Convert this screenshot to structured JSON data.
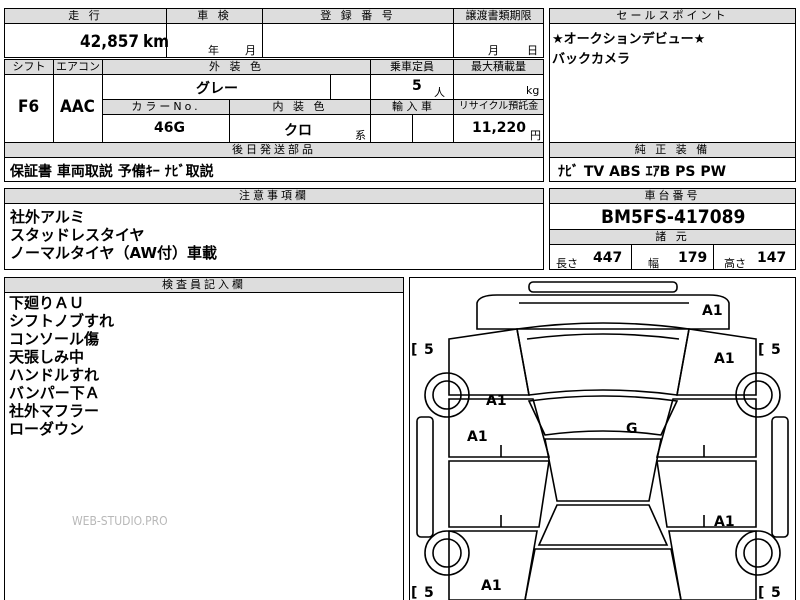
{
  "top": {
    "mileage_label": "走 行",
    "mileage_value": "42,857",
    "mileage_unit": "km",
    "inspection_label": "車 検",
    "inspection_year": "年",
    "inspection_month": "月",
    "registration_label": "登 録 番 号",
    "transfer_label": "譲渡書類期限",
    "transfer_month": "月",
    "transfer_day": "日"
  },
  "sales_point": {
    "label": "セールスポイント",
    "lines": [
      "★オークションデビュー★",
      "バックカメラ"
    ]
  },
  "row2": {
    "shift_label": "シフト",
    "shift_value": "F6",
    "aircon_label": "エアコン",
    "aircon_value": "AAC",
    "exterior_label": "外 装 色",
    "exterior_value": "グレー",
    "capacity_label": "乗車定員",
    "capacity_value": "5",
    "capacity_unit": "人",
    "load_label": "最大積載量",
    "load_unit": "kg",
    "color_no_label": "カラーNo.",
    "color_no_value": "46G",
    "interior_label": "内 装 色",
    "interior_value": "クロ",
    "interior_unit": "系",
    "import_label": "輸 入 車",
    "recycle_label": "リサイクル預託金",
    "recycle_value": "11,220",
    "recycle_unit": "円"
  },
  "later_parts": {
    "label": "後日発送部品",
    "value": "保証書 車両取説 予備ｷｰ ﾅﾋﾞ取説"
  },
  "equipment": {
    "label": "純 正 装 備",
    "value": "ﾅﾋﾞ TV ABS ｴｱB PS PW"
  },
  "notes": {
    "label": "注意事項欄",
    "lines": [
      "社外アルミ",
      "スタッドレスタイヤ",
      "ノーマルタイヤ（AW付）車載"
    ]
  },
  "chassis": {
    "label": "車台番号",
    "value": "BM5FS-417089"
  },
  "specs": {
    "label": "諸 元",
    "length_label": "長さ",
    "length_value": "447",
    "width_label": "幅",
    "width_value": "179",
    "height_label": "高さ",
    "height_value": "147"
  },
  "inspector": {
    "label": "検査員記入欄",
    "lines": [
      "下廻りＡＵ",
      "シフトノブすれ",
      "コンソール傷",
      "天張しみ中",
      "ハンドルすれ",
      "バンパー下Ａ",
      "社外マフラー",
      "ローダウン"
    ]
  },
  "watermark": "WEB-STUDIO.PRO",
  "diagram": {
    "marks": {
      "front_bumper": "A1",
      "front_left_fender": "A1",
      "front_right_fender": "A1",
      "left_front_door": "A1",
      "roof": "G",
      "right_rear_door": "A1",
      "rear_left": "A1",
      "tyre_fl": "5",
      "tyre_fr": "5",
      "tyre_rl": "5",
      "tyre_rr": "5"
    }
  }
}
